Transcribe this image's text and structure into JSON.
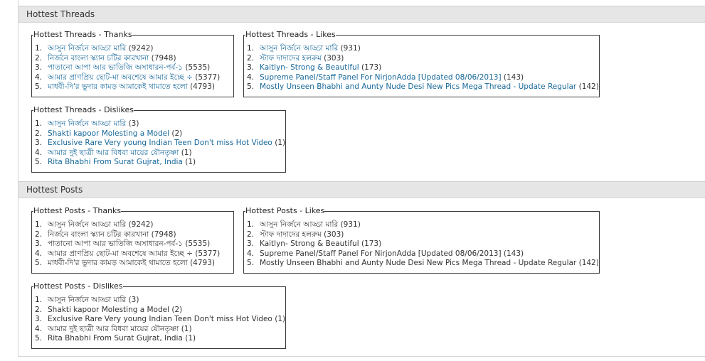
{
  "sections": [
    {
      "title": "Hottest Threads",
      "boxes": [
        {
          "legend": "Hottest Threads - Thanks",
          "items": [
            {
              "num": "1.",
              "text": "আসুন নির্জনে আড্ডা মারি",
              "count": "(9242)"
            },
            {
              "num": "2.",
              "text": "নির্জনে বাংলা স্ক্যান চটির কারখানা",
              "count": "(7948)"
            },
            {
              "num": "3.",
              "text": "পাতানো আপা আর ভাতিজি অসাধারন-পর্ব-১",
              "count": "(5535)"
            },
            {
              "num": "4.",
              "text": "আমার প্রাণপ্রিয় ছোট-মা অবশেষে আমার ইচ্ছে ÷",
              "count": "(5377)"
            },
            {
              "num": "5.",
              "text": "মাধবী-দি'র ভুদার কামড় আমাকেই থামাতে হলো",
              "count": "(4793)"
            }
          ]
        },
        {
          "legend": "Hottest Threads - Likes",
          "items": [
            {
              "num": "1.",
              "text": "আসুন নির্জনে আড্ডা মারি",
              "count": "(931)"
            },
            {
              "num": "2.",
              "text": "স্টাফ দাদাদের হলরুম",
              "count": "(303)"
            },
            {
              "num": "3.",
              "text": "Kaitlyn- Strong & Beautiful",
              "count": "(173)"
            },
            {
              "num": "4.",
              "text": "Supreme Panel/Staff Panel For NirjonAdda [Updated 08/06/2013]",
              "count": "(143)"
            },
            {
              "num": "5.",
              "text": "Mostly Unseen Bhabhi and Aunty Nude Desi New Pics Mega Thread - Update Regular",
              "count": "(142)"
            }
          ]
        },
        {
          "legend": "Hottest Threads - Dislikes",
          "items": [
            {
              "num": "1.",
              "text": "আসুন নির্জনে আড্ডা মারি",
              "count": "(3)"
            },
            {
              "num": "2.",
              "text": "Shakti kapoor Molesting a Model",
              "count": "(2)"
            },
            {
              "num": "3.",
              "text": "Exclusive Rare Very young Indian Teen Don't miss Hot Video",
              "count": "(1)"
            },
            {
              "num": "4.",
              "text": "আমার দুই ছাত্রী আর বিধবা মায়ের যৌনতৃষ্ণা",
              "count": "(1)"
            },
            {
              "num": "5.",
              "text": "Rita Bhabhi From Surat Gujrat, India",
              "count": "(1)"
            }
          ]
        }
      ]
    },
    {
      "title": "Hottest Posts",
      "boxes": [
        {
          "legend": "Hottest Posts - Thanks",
          "items": [
            {
              "num": "1.",
              "text": "আসুন নির্জনে আড্ডা মারি",
              "count": "(9242)"
            },
            {
              "num": "2.",
              "text": "নির্জনে বাংলা স্ক্যান চটির কারখানা",
              "count": "(7948)"
            },
            {
              "num": "3.",
              "text": "পাতানো আপা আর ভাতিজি অসাধারন-পর্ব-১",
              "count": "(5535)"
            },
            {
              "num": "4.",
              "text": "আমার প্রাণপ্রিয় ছোট-মা অবশেষে আমার ইচ্ছে ÷",
              "count": "(5377)"
            },
            {
              "num": "5.",
              "text": "মাধবী-দি'র ভুদার কামড় আমাকেই থামাতে হলো",
              "count": "(4793)"
            }
          ]
        },
        {
          "legend": "Hottest Posts - Likes",
          "items": [
            {
              "num": "1.",
              "text": "আসুন নির্জনে আড্ডা মারি",
              "count": "(931)"
            },
            {
              "num": "2.",
              "text": "স্টাফ দাদাদের হলরুম",
              "count": "(303)"
            },
            {
              "num": "3.",
              "text": "Kaitlyn- Strong & Beautiful",
              "count": "(173)"
            },
            {
              "num": "4.",
              "text": "Supreme Panel/Staff Panel For NirjonAdda [Updated 08/06/2013]",
              "count": "(143)"
            },
            {
              "num": "5.",
              "text": "Mostly Unseen Bhabhi and Aunty Nude Desi New Pics Mega Thread - Update Regular",
              "count": "(142)"
            }
          ]
        },
        {
          "legend": "Hottest Posts - Dislikes",
          "items": [
            {
              "num": "1.",
              "text": "আসুন নির্জনে আড্ডা মারি",
              "count": "(3)"
            },
            {
              "num": "2.",
              "text": "Shakti kapoor Molesting a Model",
              "count": "(2)"
            },
            {
              "num": "3.",
              "text": "Exclusive Rare Very young Indian Teen Don't miss Hot Video",
              "count": "(1)"
            },
            {
              "num": "4.",
              "text": "আমার দুই ছাত্রী আর বিধবা মায়ের যৌনতৃষ্ণা",
              "count": "(1)"
            },
            {
              "num": "5.",
              "text": "Rita Bhabhi From Surat Gujrat, India",
              "count": "(1)"
            }
          ]
        }
      ]
    }
  ],
  "colors": {
    "link": "#17689a",
    "header_bg": "#e6e6e6"
  }
}
